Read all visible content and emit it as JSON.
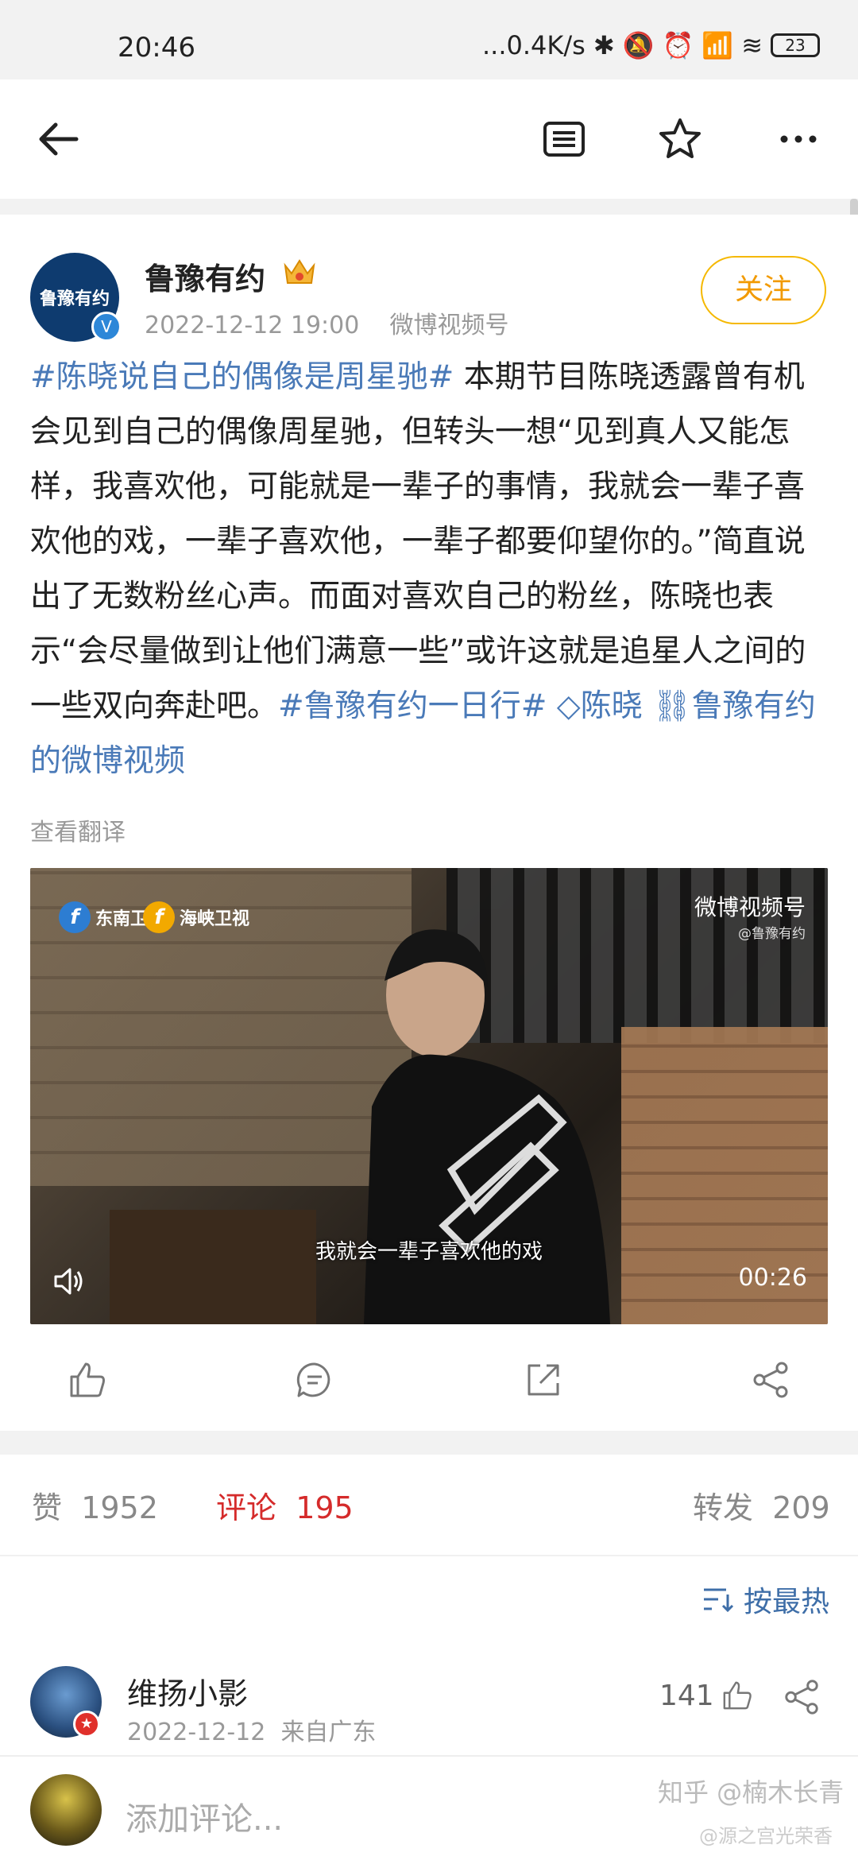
{
  "status_bar": {
    "time": "20:46",
    "network_speed": "...0.4K/s",
    "battery": "23"
  },
  "nav": {
    "icons": [
      "back-arrow-icon",
      "reader-mode-icon",
      "star-icon",
      "more-icon"
    ]
  },
  "post": {
    "author": "鲁豫有约",
    "avatar_text": "鲁豫有约",
    "datetime": "2022-12-12 19:00",
    "source": "微博视频号",
    "follow_label": "关注",
    "text_hashtag1": "#陈晓说自己的偶像是周星驰#",
    "text_body": " 本期节目陈晓透露曾有机会见到自己的偶像周星驰，但转头一想“见到真人又能怎样，我喜欢他，可能就是一辈子的事情，我就会一辈子喜欢他的戏，一辈子喜欢他，一辈子都要仰望你的。”简直说出了无数粉丝心声。而面对喜欢自己的粉丝，陈晓也表示“会尽量做到让他们满意一些”或许这就是追星人之间的一些双向奔赴吧。",
    "text_hashtag2": "#鲁豫有约一日行#",
    "text_mention": "陈晓",
    "text_link": "鲁豫有约的微博视频",
    "translate_label": "查看翻译",
    "video": {
      "logo1": "东南卫视",
      "logo2": "海峡卫视",
      "logo_glyph": "f",
      "weibo_label": "微博视频号",
      "weibo_sub": "@鲁豫有约",
      "subtitle": "我就会一辈子喜欢他的戏",
      "duration": "00:26"
    }
  },
  "stats": {
    "likes_label": "赞",
    "likes": "1952",
    "comments_label": "评论",
    "comments": "195",
    "reposts_label": "转发",
    "reposts": "209"
  },
  "sort": {
    "label": "按最热"
  },
  "comment": {
    "name": "维扬小影",
    "date": "2022-12-12",
    "location": "来自广东",
    "likes": "141"
  },
  "input": {
    "placeholder": "添加评论..."
  },
  "watermark": {
    "line1": "知乎 @楠木长青",
    "line2": "@源之宫光荣香"
  },
  "colors": {
    "hashtag": "#4a7ab8",
    "follow": "#f29a00",
    "comments_active": "#d52b2b"
  }
}
